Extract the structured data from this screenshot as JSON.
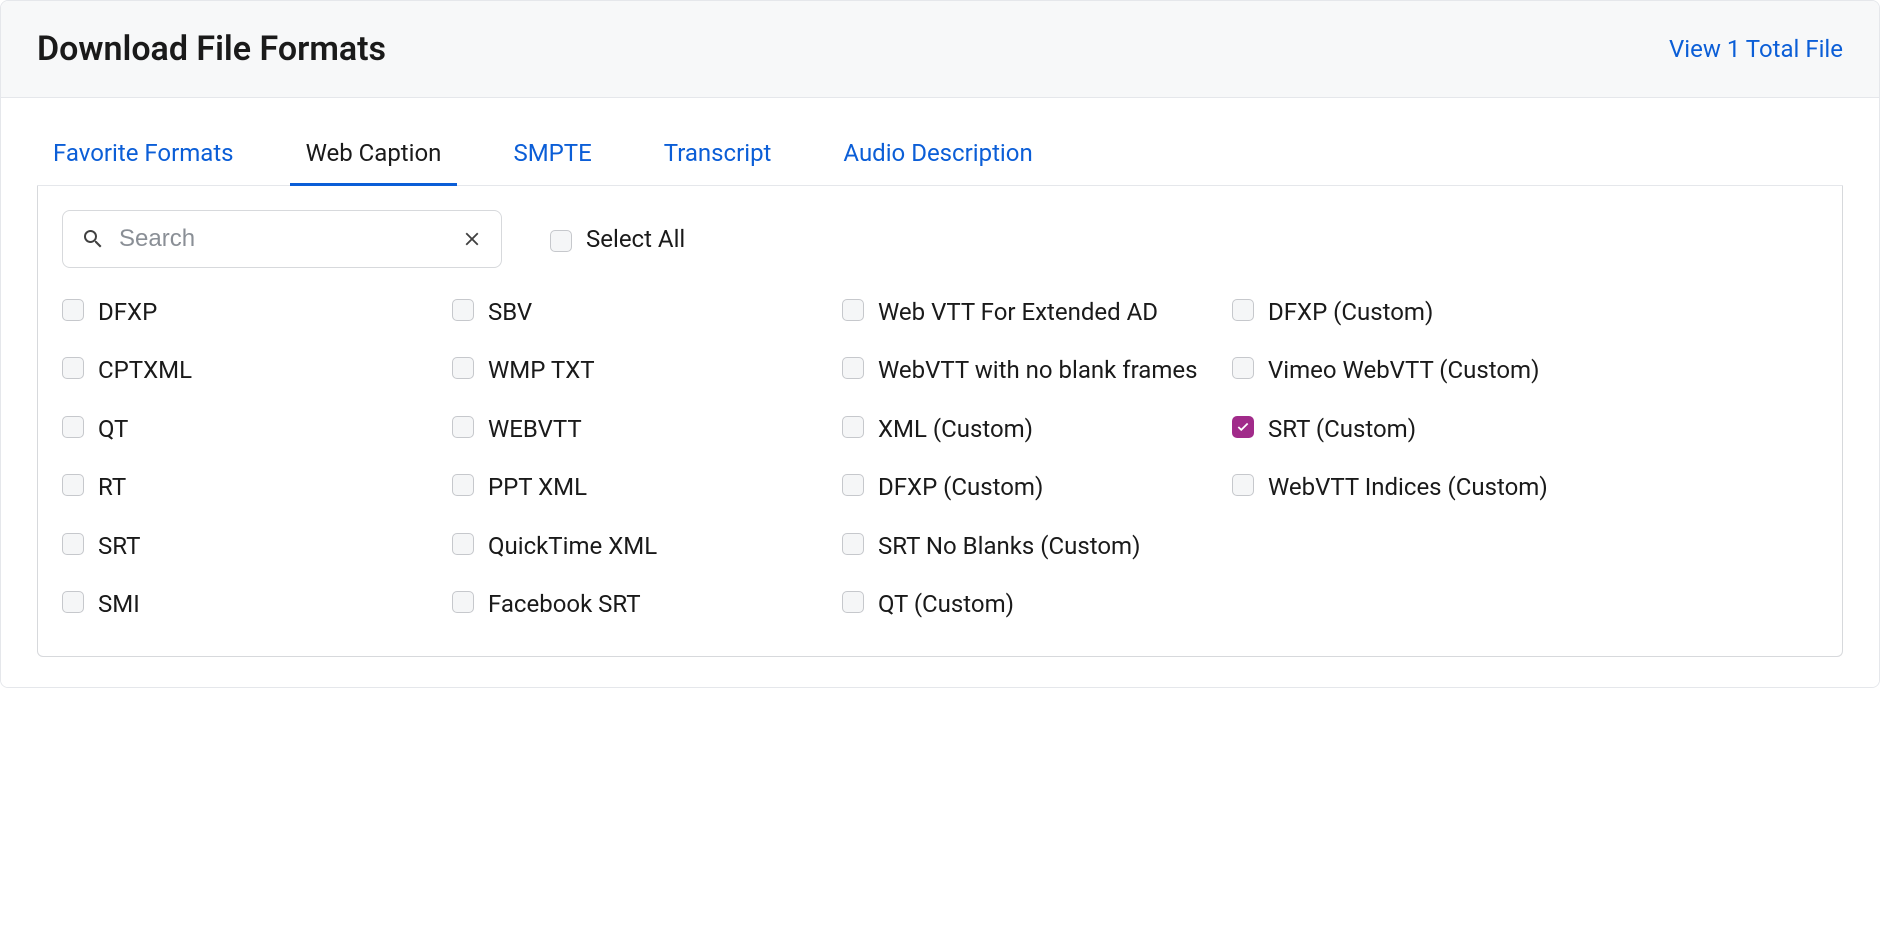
{
  "header": {
    "title": "Download File Formats",
    "link_text": "View 1 Total File"
  },
  "tabs": [
    {
      "label": "Favorite Formats",
      "active": false
    },
    {
      "label": "Web Caption",
      "active": true
    },
    {
      "label": "SMPTE",
      "active": false
    },
    {
      "label": "Transcript",
      "active": false
    },
    {
      "label": "Audio Description",
      "active": false
    }
  ],
  "search": {
    "placeholder": "Search",
    "value": ""
  },
  "select_all_label": "Select All",
  "columns": [
    [
      {
        "label": "DFXP",
        "checked": false
      },
      {
        "label": "CPTXML",
        "checked": false
      },
      {
        "label": "QT",
        "checked": false
      },
      {
        "label": "RT",
        "checked": false
      },
      {
        "label": "SRT",
        "checked": false
      },
      {
        "label": "SMI",
        "checked": false
      }
    ],
    [
      {
        "label": "SBV",
        "checked": false
      },
      {
        "label": "WMP TXT",
        "checked": false
      },
      {
        "label": "WEBVTT",
        "checked": false
      },
      {
        "label": "PPT XML",
        "checked": false
      },
      {
        "label": "QuickTime XML",
        "checked": false
      },
      {
        "label": "Facebook SRT",
        "checked": false
      }
    ],
    [
      {
        "label": "Web VTT For Extended AD",
        "checked": false
      },
      {
        "label": "WebVTT with no blank frames",
        "checked": false
      },
      {
        "label": "XML (Custom)",
        "checked": false
      },
      {
        "label": "DFXP (Custom)",
        "checked": false
      },
      {
        "label": "SRT No Blanks (Custom)",
        "checked": false
      },
      {
        "label": "QT (Custom)",
        "checked": false
      }
    ],
    [
      {
        "label": "DFXP (Custom)",
        "checked": false
      },
      {
        "label": "Vimeo WebVTT (Custom)",
        "checked": false
      },
      {
        "label": "SRT (Custom)",
        "checked": true
      },
      {
        "label": "WebVTT Indices (Custom)",
        "checked": false
      }
    ]
  ]
}
